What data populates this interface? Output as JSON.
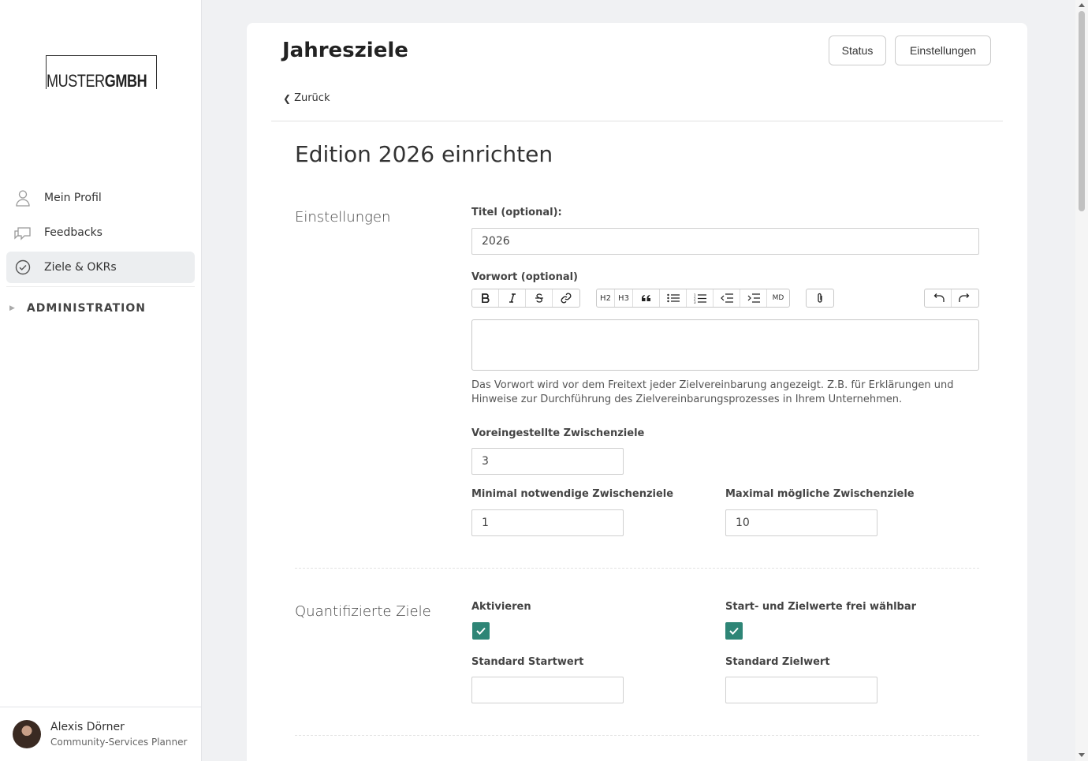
{
  "brand": {
    "logo_light": "MUSTER",
    "logo_bold": "GMBH"
  },
  "sidebar": {
    "items": [
      {
        "label": "Mein Profil",
        "icon": "user-icon"
      },
      {
        "label": "Feedbacks",
        "icon": "chat-icon"
      },
      {
        "label": "Ziele & OKRs",
        "icon": "check-circle-icon",
        "active": true
      }
    ],
    "admin_label": "ADMINISTRATION"
  },
  "user": {
    "name": "Alexis Dörner",
    "role": "Community-Services Planner"
  },
  "header": {
    "title": "Jahresziele",
    "status_label": "Status",
    "settings_label": "Einstellungen",
    "back_label": "Zurück"
  },
  "form": {
    "heading": "Edition 2026 einrichten",
    "settings_section": "Einstellungen",
    "title_label": "Titel (optional):",
    "title_value": "2026",
    "preface_label": "Vorwort (optional)",
    "toolbar": {
      "h2": "H2",
      "h3": "H3",
      "md": "MD"
    },
    "preface_help": "Das Vorwort wird vor dem Freitext jeder Zielvereinbarung angezeigt. Z.B. für Erklärungen und Hinweise zur Durchführung des Zielvereinbarungsprozesses in Ihrem Unternehmen.",
    "default_milestones_label": "Voreingestellte Zwischenziele",
    "default_milestones_value": "3",
    "min_milestones_label": "Minimal notwendige Zwischenziele",
    "min_milestones_value": "1",
    "max_milestones_label": "Maximal mögliche Zwischenziele",
    "max_milestones_value": "10",
    "quant_section": "Quantifizierte Ziele",
    "activate_label": "Aktivieren",
    "activate_checked": true,
    "free_values_label": "Start- und Zielwerte frei wählbar",
    "free_values_checked": true,
    "start_value_label": "Standard Startwert",
    "start_value": "",
    "target_value_label": "Standard Zielwert",
    "target_value": ""
  },
  "colors": {
    "accent": "#2e8576",
    "active_nav": "#eceef0"
  }
}
